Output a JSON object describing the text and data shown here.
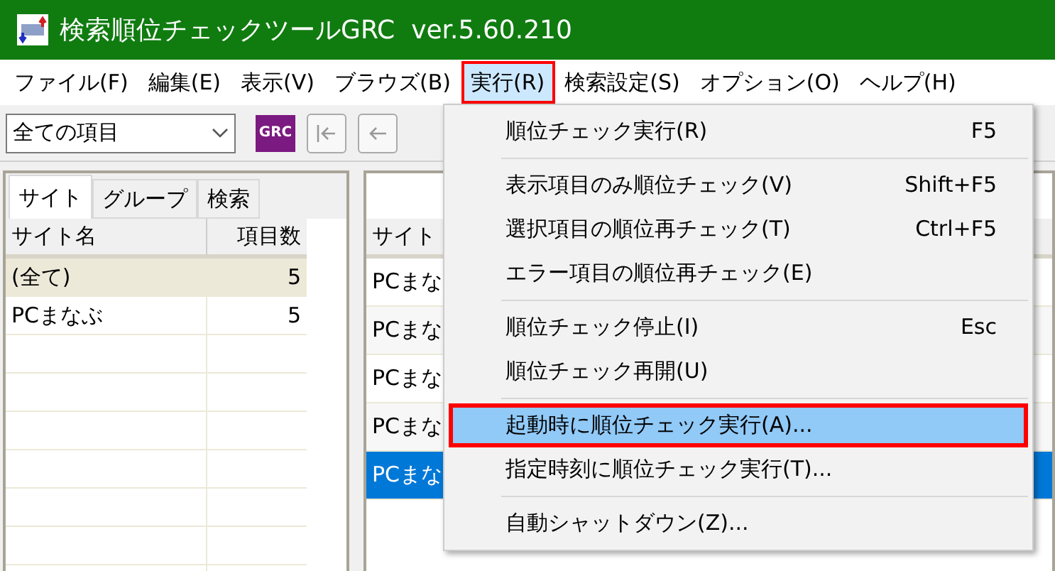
{
  "window": {
    "title": "検索順位チェックツールGRC  ver.5.60.210"
  },
  "menu_bar": [
    {
      "label": "ファイル(F)",
      "selected": false
    },
    {
      "label": "編集(E)",
      "selected": false
    },
    {
      "label": "表示(V)",
      "selected": false
    },
    {
      "label": "ブラウズ(B)",
      "selected": false
    },
    {
      "label": "実行(R)",
      "selected": true
    },
    {
      "label": "検索設定(S)",
      "selected": false
    },
    {
      "label": "オプション(O)",
      "selected": false
    },
    {
      "label": "ヘルプ(H)",
      "selected": false
    }
  ],
  "toolbar": {
    "filter": {
      "value": "全ての項目"
    },
    "logo_label": "GRC"
  },
  "left_panel": {
    "tabs": [
      {
        "label": "サイト",
        "selected": true
      },
      {
        "label": "グループ",
        "selected": false
      },
      {
        "label": "検索",
        "selected": false
      }
    ],
    "columns": [
      "サイト名",
      "項目数"
    ],
    "rows": [
      {
        "name": "(全て)",
        "count": "5",
        "selected": true
      },
      {
        "name": "PCまなぶ",
        "count": "5",
        "selected": false
      }
    ]
  },
  "right_panel": {
    "columns": [
      "サイト"
    ],
    "rows": [
      {
        "cell": "PCまな",
        "selected": false
      },
      {
        "cell": "PCまな",
        "selected": false
      },
      {
        "cell": "PCまな",
        "selected": false
      },
      {
        "cell": "PCまな",
        "selected": false
      },
      {
        "cell": "PCまな",
        "selected": true
      }
    ]
  },
  "dropdown_menu": {
    "items": [
      {
        "kind": "item",
        "label": "順位チェック実行(R)",
        "shortcut": "F5",
        "highlighted": false
      },
      {
        "kind": "separator"
      },
      {
        "kind": "item",
        "label": "表示項目のみ順位チェック(V)",
        "shortcut": "Shift+F5",
        "highlighted": false
      },
      {
        "kind": "item",
        "label": "選択項目の順位再チェック(T)",
        "shortcut": "Ctrl+F5",
        "highlighted": false
      },
      {
        "kind": "item",
        "label": "エラー項目の順位再チェック(E)",
        "highlighted": false
      },
      {
        "kind": "separator"
      },
      {
        "kind": "item",
        "label": "順位チェック停止(I)",
        "shortcut": "Esc",
        "highlighted": false
      },
      {
        "kind": "item",
        "label": "順位チェック再開(U)",
        "highlighted": false
      },
      {
        "kind": "separator"
      },
      {
        "kind": "item",
        "label": "起動時に順位チェック実行(A)...",
        "highlighted": true
      },
      {
        "kind": "item",
        "label": "指定時刻に順位チェック実行(T)...",
        "highlighted": false
      },
      {
        "kind": "separator"
      },
      {
        "kind": "item",
        "label": "自動シャットダウン(Z)...",
        "highlighted": false
      }
    ]
  }
}
